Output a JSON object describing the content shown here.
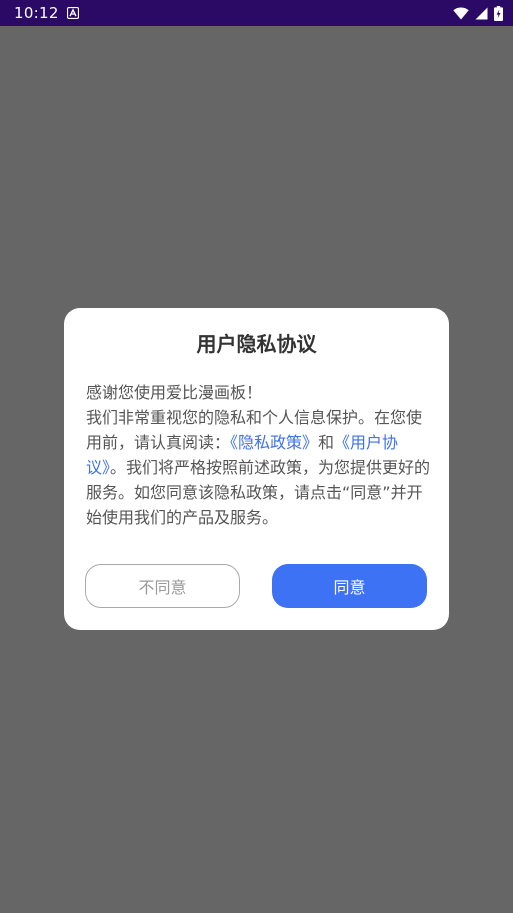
{
  "status_bar": {
    "time": "10:12",
    "app_icon": "a-letter-icon",
    "icons": [
      "wifi-icon",
      "signal-icon",
      "battery-charging-icon"
    ]
  },
  "dialog": {
    "title": "用户隐私协议",
    "greeting": "感谢您使用爱比漫画板！",
    "body_part1": "我们非常重视您的隐私和个人信息保护。在您使用前，请认真阅读：",
    "privacy_link": "《隐私政策》",
    "conjunction": "和",
    "user_agreement_link": "《用户协议》",
    "body_part2": "。我们将严格按照前述政策，为您提供更好的服务。如您同意该隐私政策，请点击“同意”并开始使用我们的产品及服务。",
    "disagree_label": "不同意",
    "agree_label": "同意"
  },
  "colors": {
    "overlay": "#666666",
    "status_bar": "#2b0a66",
    "accent": "#3d72f5",
    "link": "#3d72e8"
  }
}
